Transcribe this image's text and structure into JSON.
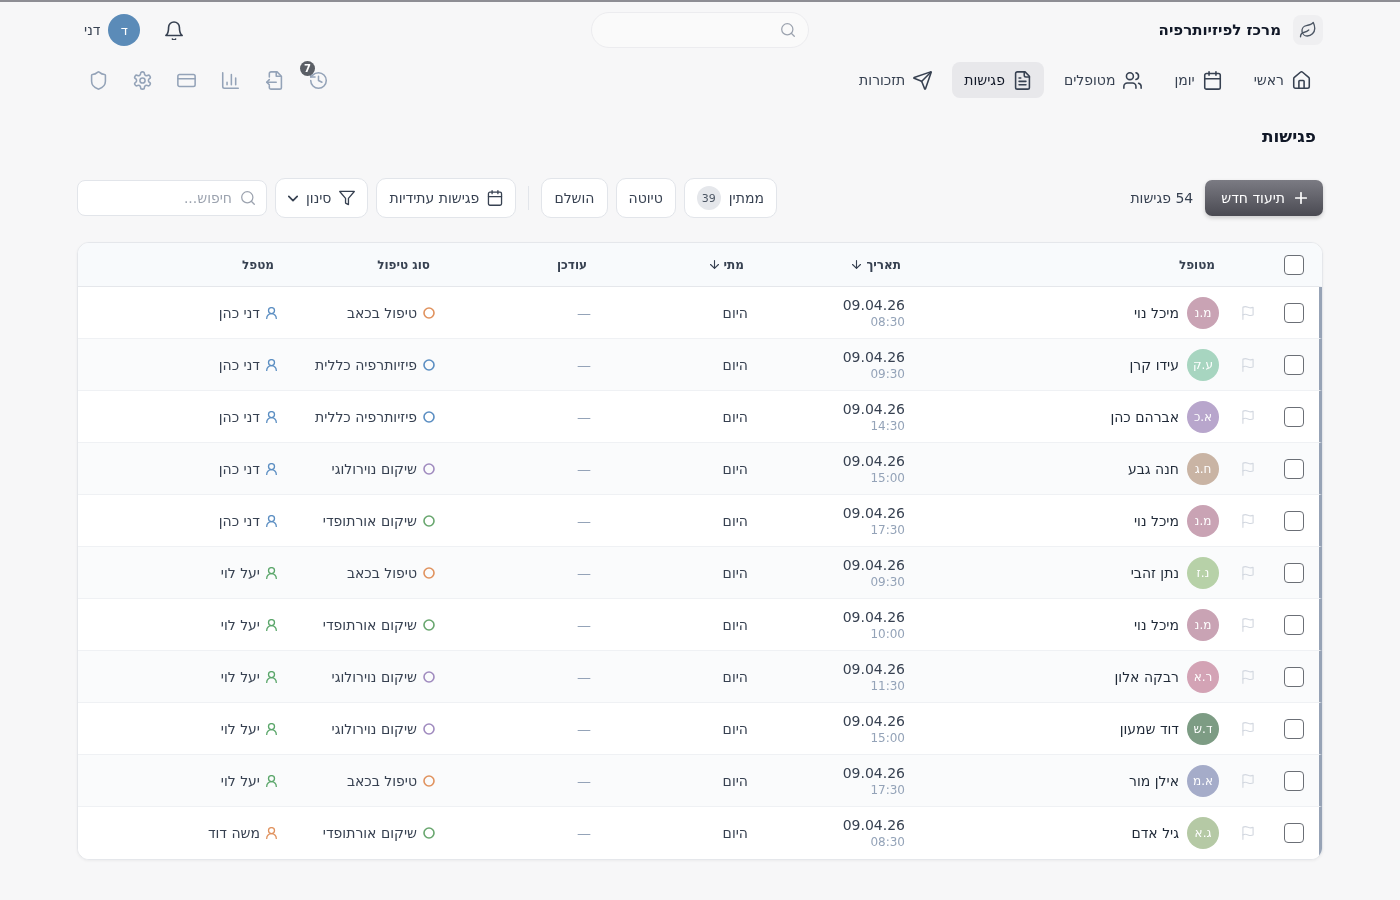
{
  "header": {
    "brand": "מרכז לפיזיותרפיה",
    "user": {
      "initial": "ד",
      "name": "דני"
    },
    "tool_badge": "7"
  },
  "nav": [
    {
      "label": "ראשי",
      "selected": false
    },
    {
      "label": "יומן",
      "selected": false
    },
    {
      "label": "מטופלים",
      "selected": false
    },
    {
      "label": "פגישות",
      "selected": true
    },
    {
      "label": "תזכורות",
      "selected": false
    }
  ],
  "page_title": "פגישות",
  "toolbar": {
    "new_button": "תיעוד חדש",
    "count": "54 פגישות",
    "status_filters": [
      {
        "label": "ממתין",
        "count": "39",
        "selected": false
      },
      {
        "label": "טיוטה",
        "selected": false
      },
      {
        "label": "הושלם",
        "selected": false
      }
    ],
    "upcoming_button": "פגישות עתידיות",
    "filter_button": "סינון",
    "search": {
      "placeholder": "חיפוש..."
    }
  },
  "table": {
    "select_all": {
      "checked": false
    },
    "columns": [
      {
        "label": "מטופל",
        "sorted": false
      },
      {
        "label": "תאריך",
        "sorted": true
      },
      {
        "label": "מתי",
        "sorted": true
      },
      {
        "label": "עודכן",
        "sorted": false
      },
      {
        "label": "סוג טיפול",
        "sorted": false
      },
      {
        "label": "מטפל",
        "sorted": false
      }
    ],
    "rows": [
      {
        "checked": false,
        "flagged": false,
        "patient": {
          "initials": "מ.נ",
          "name": "מיכל נוי",
          "color": "#c9a3b4"
        },
        "date": "09.04.26",
        "time": "08:30",
        "when": "היום",
        "updated": "—",
        "treatment": {
          "label": "טיפול בכאב",
          "color": "#e0925e"
        },
        "therapist": {
          "name": "דני כהן",
          "color": "#5b8ec2"
        }
      },
      {
        "checked": false,
        "flagged": false,
        "patient": {
          "initials": "ע.ק",
          "name": "עידו קרן",
          "color": "#a7d5c0"
        },
        "date": "09.04.26",
        "time": "09:30",
        "when": "היום",
        "updated": "—",
        "treatment": {
          "label": "פיזיותרפיה כללית",
          "color": "#5b8ec2"
        },
        "therapist": {
          "name": "דני כהן",
          "color": "#5b8ec2"
        }
      },
      {
        "checked": false,
        "flagged": false,
        "patient": {
          "initials": "א.כ",
          "name": "אברהם כהן",
          "color": "#b8a6cc"
        },
        "date": "09.04.26",
        "time": "14:30",
        "when": "היום",
        "updated": "—",
        "treatment": {
          "label": "פיזיותרפיה כללית",
          "color": "#5b8ec2"
        },
        "therapist": {
          "name": "דני כהן",
          "color": "#5b8ec2"
        }
      },
      {
        "checked": false,
        "flagged": false,
        "patient": {
          "initials": "ח.ג",
          "name": "חנה גבע",
          "color": "#c9b4a4"
        },
        "date": "09.04.26",
        "time": "15:00",
        "when": "היום",
        "updated": "—",
        "treatment": {
          "label": "שיקום נוירולוגי",
          "color": "#a08bbf"
        },
        "therapist": {
          "name": "דני כהן",
          "color": "#5b8ec2"
        }
      },
      {
        "checked": false,
        "flagged": false,
        "patient": {
          "initials": "מ.נ",
          "name": "מיכל נוי",
          "color": "#c9a3b4"
        },
        "date": "09.04.26",
        "time": "17:30",
        "when": "היום",
        "updated": "—",
        "treatment": {
          "label": "שיקום אורתופדי",
          "color": "#68a66e"
        },
        "therapist": {
          "name": "דני כהן",
          "color": "#5b8ec2"
        }
      },
      {
        "checked": false,
        "flagged": false,
        "patient": {
          "initials": "נ.ז",
          "name": "נתן זהבי",
          "color": "#b7d1a8"
        },
        "date": "09.04.26",
        "time": "09:30",
        "when": "היום",
        "updated": "—",
        "treatment": {
          "label": "טיפול בכאב",
          "color": "#e0925e"
        },
        "therapist": {
          "name": "יעל לוי",
          "color": "#5aa66a"
        }
      },
      {
        "checked": false,
        "flagged": false,
        "patient": {
          "initials": "מ.נ",
          "name": "מיכל נוי",
          "color": "#c9a3b4"
        },
        "date": "09.04.26",
        "time": "10:00",
        "when": "היום",
        "updated": "—",
        "treatment": {
          "label": "שיקום אורתופדי",
          "color": "#68a66e"
        },
        "therapist": {
          "name": "יעל לוי",
          "color": "#5aa66a"
        }
      },
      {
        "checked": false,
        "flagged": false,
        "patient": {
          "initials": "ר.א",
          "name": "רבקה אלון",
          "color": "#d3a3b5"
        },
        "date": "09.04.26",
        "time": "11:30",
        "when": "היום",
        "updated": "—",
        "treatment": {
          "label": "שיקום נוירולוגי",
          "color": "#a08bbf"
        },
        "therapist": {
          "name": "יעל לוי",
          "color": "#5aa66a"
        }
      },
      {
        "checked": false,
        "flagged": false,
        "patient": {
          "initials": "ד.ש",
          "name": "דוד שמעון",
          "color": "#7d9c84"
        },
        "date": "09.04.26",
        "time": "15:00",
        "when": "היום",
        "updated": "—",
        "treatment": {
          "label": "שיקום נוירולוגי",
          "color": "#a08bbf"
        },
        "therapist": {
          "name": "יעל לוי",
          "color": "#5aa66a"
        }
      },
      {
        "checked": false,
        "flagged": false,
        "patient": {
          "initials": "א.מ",
          "name": "אילן מור",
          "color": "#a5acc9"
        },
        "date": "09.04.26",
        "time": "17:30",
        "when": "היום",
        "updated": "—",
        "treatment": {
          "label": "טיפול בכאב",
          "color": "#e0925e"
        },
        "therapist": {
          "name": "יעל לוי",
          "color": "#5aa66a"
        }
      },
      {
        "checked": false,
        "flagged": false,
        "patient": {
          "initials": "ג.א",
          "name": "גיל אדם",
          "color": "#b5c9a5"
        },
        "date": "09.04.26",
        "time": "08:30",
        "when": "היום",
        "updated": "—",
        "treatment": {
          "label": "שיקום אורתופדי",
          "color": "#68a66e"
        },
        "therapist": {
          "name": "משה דוד",
          "color": "#e0925e"
        }
      }
    ]
  }
}
